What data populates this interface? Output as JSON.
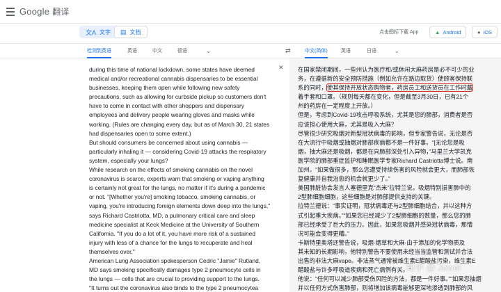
{
  "header": {
    "logo_google": "Google",
    "logo_product": "翻译"
  },
  "modes": {
    "text_label": "文字",
    "docs_label": "文档",
    "app_hint": "点击图标下载 App",
    "android_label": "Android",
    "ios_label": "iOS"
  },
  "source_langs": {
    "detect": "检测到英语",
    "l1": "英语",
    "l2": "中文",
    "l3": "德语"
  },
  "target_langs": {
    "l1": "中文(简体)",
    "l2": "英语",
    "l3": "日语"
  },
  "source_text": [
    "during this time of national lockdown, some states have deemed",
    "medical and/or recreational cannabis dispensaries to be essential",
    "businesses, keeping them open while following new safety",
    "precautions, such as allowing for curbside pickup so customers don't",
    "have to come in contact with other shoppers and dispensary",
    "employees and delivery people wearing gloves and masks while",
    "working. (Rules are changing every day, but as of March 30, 21 states",
    "had dispensaries open to some extent.)",
    "But should consumers be concerned about using cannabis —",
    "particularly inhaling it — considering Covid-19 attacks the respiratory",
    "system, especially your lungs?",
    "While research on the effects of smoking cannabis on the novel",
    "coronavirus is scarce, experts warn that smoking or vaping anything",
    "is certainly not great for the lungs, no matter if it's during a pandemic",
    "or not. \"[Whether you're] smoking tobacco, smoking cannabis, or",
    "vaping, you're introducing foreign elements down deep into the lungs,\"",
    "says Richard Castriotta, MD, a pulmonary critical care and sleep",
    "medicine specialist at Keck Medicine at the University of Southern",
    "California. \"If you do a lot of it, you have more risk of a sustained",
    "injury with less of a chance for the lungs to recuperate and heal",
    "themselves over.\"",
    "American Lung Association spokesperson Cedric \"Jamie\" Rutland,",
    "MD says smoking specifically damages type 2 pneumocyte cells in",
    "the lungs — cells that are crucial to providing support to the lungs.",
    "\"It turns out the coronavirus also binds to the type 2 pneumocytea"
  ],
  "target_text": {
    "l1": "在国家禁闭期间，一些州认为医疗和/或休闲大麻药房是必不可少的业",
    "l2": "务，在遵循新的安全预防措施（例如允许在路边取货）使顾客保持联",
    "l3_pre": "系的同时，",
    "l3_hl": "使其保持开放状态购物者，药房员工和送货员在工作时戴",
    "l4": "着手套和口罩。（规则每天都在变化，但是截至3月30日，已有21个",
    "l5": "州的药房在一定程度上开放。）",
    "l6": "但是，考虑到Covid-19攻击呼吸系统，尤其是您的肺部，消费者是否",
    "l7": "应该担心使用大麻，尤其是吸入大麻？",
    "l8": "尽管很少研究吸烟对新型冠状病毒的影响，但专家警告说，无论是否",
    "l9": "在大流行中吸烟或抽烟对肺部疾病都不是一件好事。“[无论您是吸",
    "l10": "烟，抽大麻还是吸烟，都是在向肺部深处引入异物，”马里兰大学凯克",
    "l11": "医学院的肺部重症监护和睡眠医学专家Richard Castriotta博士说。南",
    "l12": "加州。“如果做很多，那么您遭受持续伤害的风险就会更大，而肺部恢",
    "l13": "复健康并自我治愈的机会就更少了。”",
    "l14": "美国肺脏协会发言人塞德里克“杰米”拉特兰说，吸烟特别损害肺中的",
    "l15": "2型肺细胞细胞，这些细胞是对肺部提供支持的关键。",
    "l16": "拉特兰德说：“事实证明，冠状病毒还与2型肺细胞结合，并以这种方",
    "l17": "式引起重大疾病。”“如果您已经减少了2型肺细胞的数量，那么您的肺",
    "l18": "部已经承受了巨大的压力。因此，如果您吸烟并感染冠状病毒，那情",
    "l19": "况可能会变得更糟。”",
    "l20": "卡斯特里奥塔还警告说，吸烟-烟草和大麻-由于添加的化学物质及",
    "l21": "其未知的长期影响，他特别警告不要使用未经当当监管和测试并合法",
    "l22": "出售的非法大麻vape。非法蒸气通常被维生素E醋酸盐污染，维生素E",
    "l23": "醋酸盐与许多呼吸道疾病和死亡病例有关。“",
    "l24": "他说：“任何可以减少肺部受伤风险的方法，都是一件好事。”“如果您抽烟",
    "l25": "并以任何方式伤害肺部，则将增加该病毒能够更深地渗透到肺部的风"
  },
  "watermark": "知乎 @ Jewel"
}
